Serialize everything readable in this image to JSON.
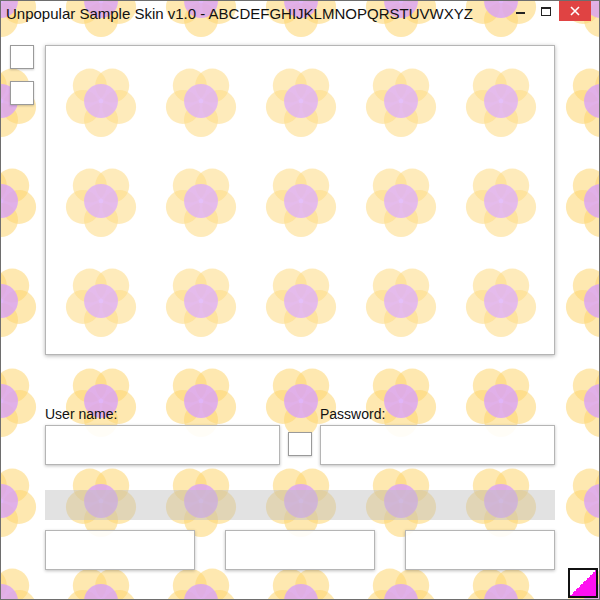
{
  "window": {
    "title": "Unpopular Sample Skin v1.0 - ABCDEFGHIJKLMNOPQRSTUVWXYZ"
  },
  "side_checkboxes": [
    {
      "checked": false
    },
    {
      "checked": false
    }
  ],
  "login": {
    "username": {
      "label": "User name:",
      "value": ""
    },
    "password": {
      "label": "Password:",
      "value": ""
    },
    "remember": {
      "checked": false
    }
  },
  "buttons": [
    {
      "label": ""
    },
    {
      "label": ""
    },
    {
      "label": ""
    }
  ]
}
